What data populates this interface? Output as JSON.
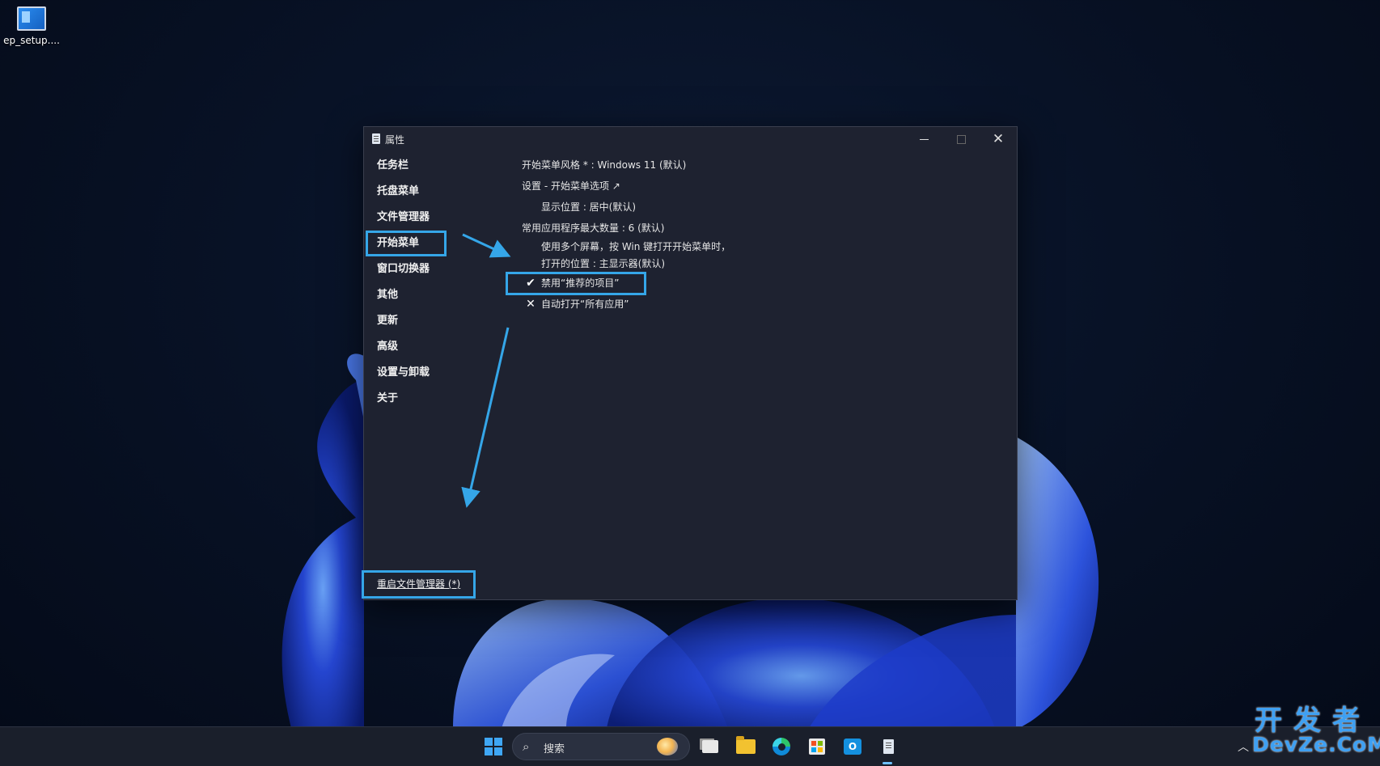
{
  "desktop": {
    "icon_label": "ep_setup...."
  },
  "window": {
    "title": "属性",
    "controls": {
      "minimize": "—",
      "maximize": "□",
      "close": "✕"
    }
  },
  "sidebar": {
    "items": [
      {
        "label": "任务栏"
      },
      {
        "label": "托盘菜单"
      },
      {
        "label": "文件管理器"
      },
      {
        "label": "开始菜单",
        "active": true
      },
      {
        "label": "窗口切换器"
      },
      {
        "label": "其他"
      },
      {
        "label": "更新"
      },
      {
        "label": "高级"
      },
      {
        "label": "设置与卸载"
      },
      {
        "label": "关于"
      }
    ],
    "restart_link": "重启文件管理器 (*)"
  },
  "content": {
    "start_style": "开始菜单风格 * : Windows 11 (默认)",
    "settings_link": "设置 - 开始菜单选项 ↗",
    "display_position": "显示位置 : 居中(默认)",
    "max_apps": "常用应用程序最大数量 : 6 (默认)",
    "multi_monitor_line1": "使用多个屏幕，按 Win 键打开开始菜单时，",
    "multi_monitor_line2": "打开的位置 : 主显示器(默认)",
    "disable_recommended": {
      "label": "禁用“推荐的项目”",
      "state": "checked",
      "icon": "check-icon"
    },
    "auto_open_all_apps": {
      "label": "自动打开“所有应用”",
      "state": "unchecked",
      "icon": "cross-icon"
    }
  },
  "taskbar": {
    "search_label": "搜索",
    "pinned": [
      "start",
      "search",
      "task-view",
      "file-explorer",
      "edge",
      "store",
      "outlook",
      "properties"
    ],
    "accent": "#3fa7f5"
  },
  "watermark": {
    "cn": "开发者",
    "en": "DevZe.CoM"
  },
  "annotation_color": "#35a6e8"
}
